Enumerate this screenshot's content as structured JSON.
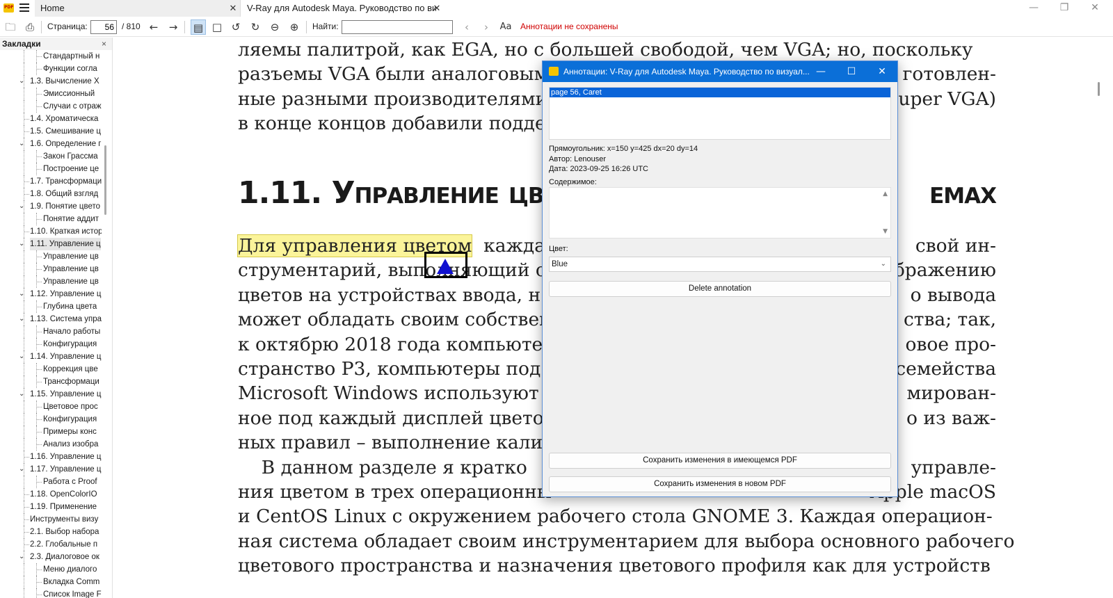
{
  "tabs": {
    "home": "Home",
    "document": "V-Ray для Autodesk Maya. Руководство по виз…"
  },
  "window_controls": {
    "minimize": "—",
    "maximize": "❐",
    "close": "✕"
  },
  "toolbar": {
    "page_label": "Страница:",
    "page_value": "56",
    "page_total": "/ 810",
    "find_label": "Найти:",
    "find_value": "",
    "status": "Аннотации не сохранены",
    "icons": [
      "open-icon",
      "print-icon",
      "back-icon",
      "forward-icon",
      "single-page-icon",
      "fit-page-icon",
      "rotate-left-icon",
      "rotate-right-icon",
      "zoom-out-icon",
      "zoom-in-icon",
      "find-prev-icon",
      "find-next-icon",
      "match-case-icon"
    ],
    "colors": {
      "status_red": "#d00000",
      "active_bg": "#cfe3f7"
    }
  },
  "sidebar": {
    "title": "Закладки",
    "close": "×",
    "items": [
      {
        "label": "Стандартный н",
        "level": 2
      },
      {
        "label": "Функции согла",
        "level": 2
      },
      {
        "label": "1.3. Вычисление X",
        "level": 1,
        "expanded": true
      },
      {
        "label": "Эмиссионный",
        "level": 2
      },
      {
        "label": "Случаи с отраж",
        "level": 2
      },
      {
        "label": "1.4. Хроматическа",
        "level": 1
      },
      {
        "label": "1.5. Смешивание ц",
        "level": 1
      },
      {
        "label": "1.6. Определение г",
        "level": 1,
        "expanded": true
      },
      {
        "label": "Закон Грассма",
        "level": 2
      },
      {
        "label": "Построение це",
        "level": 2
      },
      {
        "label": "1.7. Трансформаци",
        "level": 1
      },
      {
        "label": "1.8. Общий взгляд",
        "level": 1
      },
      {
        "label": "1.9. Понятие цвето",
        "level": 1,
        "expanded": true
      },
      {
        "label": "Понятие аддит",
        "level": 2
      },
      {
        "label": "1.10. Краткая истор",
        "level": 1
      },
      {
        "label": "1.11. Управление ц",
        "level": 1,
        "expanded": true,
        "selected": true
      },
      {
        "label": "Управление цв",
        "level": 2
      },
      {
        "label": "Управление цв",
        "level": 2
      },
      {
        "label": "Управление цв",
        "level": 2
      },
      {
        "label": "1.12. Управление ц",
        "level": 1,
        "expanded": true
      },
      {
        "label": "Глубина цвета",
        "level": 2
      },
      {
        "label": "1.13. Система упра",
        "level": 1,
        "expanded": true
      },
      {
        "label": "Начало работы",
        "level": 2
      },
      {
        "label": "Конфигурация",
        "level": 2
      },
      {
        "label": "1.14. Управление ц",
        "level": 1,
        "expanded": true
      },
      {
        "label": "Коррекция цве",
        "level": 2
      },
      {
        "label": "Трансформаци",
        "level": 2
      },
      {
        "label": "1.15. Управление ц",
        "level": 1,
        "expanded": true
      },
      {
        "label": "Цветовое прос",
        "level": 2
      },
      {
        "label": "Конфигурация",
        "level": 2
      },
      {
        "label": "Примеры конс",
        "level": 2
      },
      {
        "label": "Анализ изобра",
        "level": 2
      },
      {
        "label": "1.16. Управление ц",
        "level": 1
      },
      {
        "label": "1.17. Управление ц",
        "level": 1,
        "expanded": true
      },
      {
        "label": "Работа с Proof",
        "level": 2
      },
      {
        "label": "1.18. OpenColorIO",
        "level": 1
      },
      {
        "label": "1.19. Применение",
        "level": 1
      },
      {
        "label": "Инструменты визу",
        "level": 0
      },
      {
        "label": "2.1. Выбор набора",
        "level": 1
      },
      {
        "label": "2.2. Глобальные п",
        "level": 1
      },
      {
        "label": "2.3. Диалоговое ок",
        "level": 1,
        "expanded": true
      },
      {
        "label": "Меню диалого",
        "level": 2
      },
      {
        "label": "Вкладка Comm",
        "level": 2
      },
      {
        "label": "Список Image F",
        "level": 2
      }
    ]
  },
  "document": {
    "top_lines": [
      "ляемы палитрой, как EGA, но с большей свободой, чем VGA; но, поскольку",
      "разъемы VGA были аналоговым",
      "ные разными производителями",
      "в конце концов добавили подде"
    ],
    "top_right_fragments": [
      "",
      "готовлен-",
      "uper VGA)",
      ""
    ],
    "heading_left": "1.11. Управление цвет",
    "heading_right": "емах",
    "highlight": "Для управления цветом",
    "para1": [
      [
        "Для управления цветом",
        "каждая",
        "свой ин-"
      ],
      [
        "струментарий, выполняющий с",
        "",
        "бражению"
      ],
      [
        "цветов на устройствах ввода, н",
        "",
        "о вывода"
      ],
      [
        "может обладать своим собствен",
        "",
        "ства; так,"
      ],
      [
        "к октябрю 2018 года компьютер",
        "",
        "овое про-"
      ],
      [
        "странство P3, компьютеры под у",
        "",
        "семейства"
      ],
      [
        "Microsoft Windows используют ц",
        "",
        "мирован-"
      ],
      [
        "ное под каждый дисплей цветов",
        "",
        "о из важ-"
      ],
      [
        "ных правил – выполнение калиб",
        "",
        ""
      ]
    ],
    "para2": [
      [
        "    В данном разделе я кратко",
        "управле-"
      ],
      [
        "ния цветом в трех операционны",
        "Apple macOS"
      ],
      [
        "и CentOS Linux с окружением рабочего стола GNOME 3. Каждая операцион-",
        ""
      ],
      [
        "ная система обладает своим инструментарием для выбора основного рабочего",
        ""
      ],
      [
        "цветового пространства и назначения цветового профиля как для устройств",
        ""
      ]
    ]
  },
  "dialog": {
    "title": "Аннотации: V-Ray для Autodesk Maya. Руководство по визуал...",
    "list_items": [
      "page 56, Caret"
    ],
    "rect": "Прямоугольник: x=150 y=425 dx=20 dy=14",
    "author": "Автор: Lenouser",
    "date": "Дата: 2023-09-25 16:26 UTC",
    "contents_label": "Содержимое:",
    "contents_value": "",
    "color_label": "Цвет:",
    "color_value": "Blue",
    "delete_button": "Delete annotation",
    "save_existing_button": "Сохранить изменения в имеющемся PDF",
    "save_new_button": "Сохранить изменения в новом PDF",
    "colors": {
      "titlebar": "#0b6fd8",
      "selection": "#0a64d8",
      "caret": "#1010d0",
      "highlight": "#fbf49a"
    }
  }
}
